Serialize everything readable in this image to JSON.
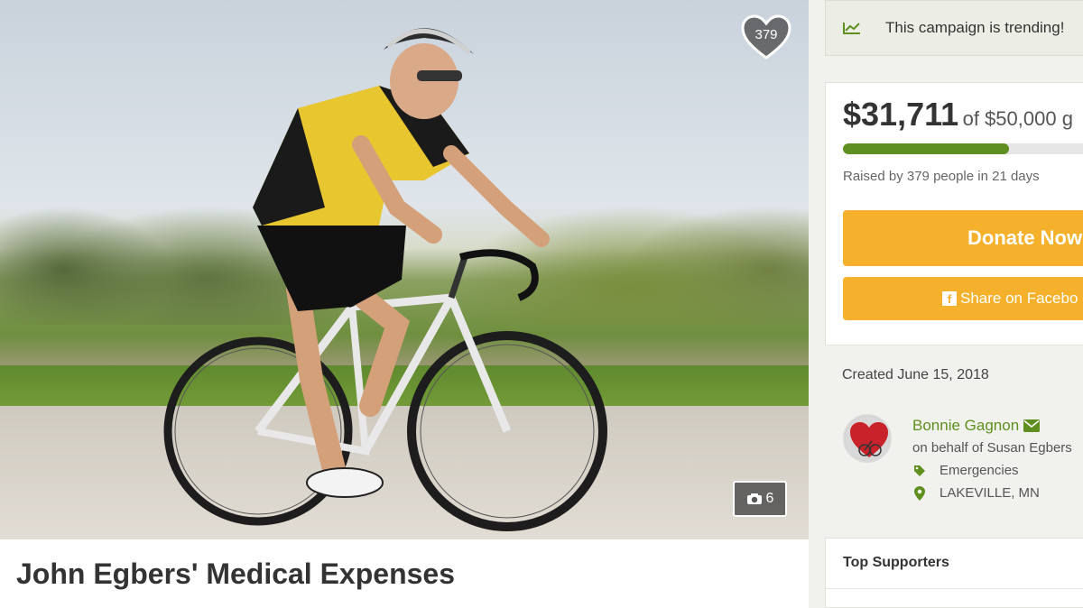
{
  "trending": {
    "text": "This campaign is trending!",
    "icon": "trend-chart-icon"
  },
  "campaign": {
    "title": "John Egbers' Medical Expenses",
    "hearts": "379",
    "photo_count": "6",
    "photo_alt": "Cyclist riding a road bike",
    "raised_amount": "$31,711",
    "goal_text": "of $50,000 g",
    "progress_fraction": 0.634,
    "raised_text": "Raised by 379 people in 21 days",
    "donate_label": "Donate Now",
    "share_label": "Share on Facebo",
    "created": "Created June 15, 2018"
  },
  "organizer": {
    "name": "Bonnie Gagnon",
    "behalf": "on behalf of Susan Egbers",
    "category": "Emergencies",
    "location": "LAKEVILLE, MN"
  },
  "supporters": {
    "title": "Top Supporters"
  },
  "colors": {
    "accent_green": "#5f8f1e",
    "button_orange": "#f5b12b"
  }
}
